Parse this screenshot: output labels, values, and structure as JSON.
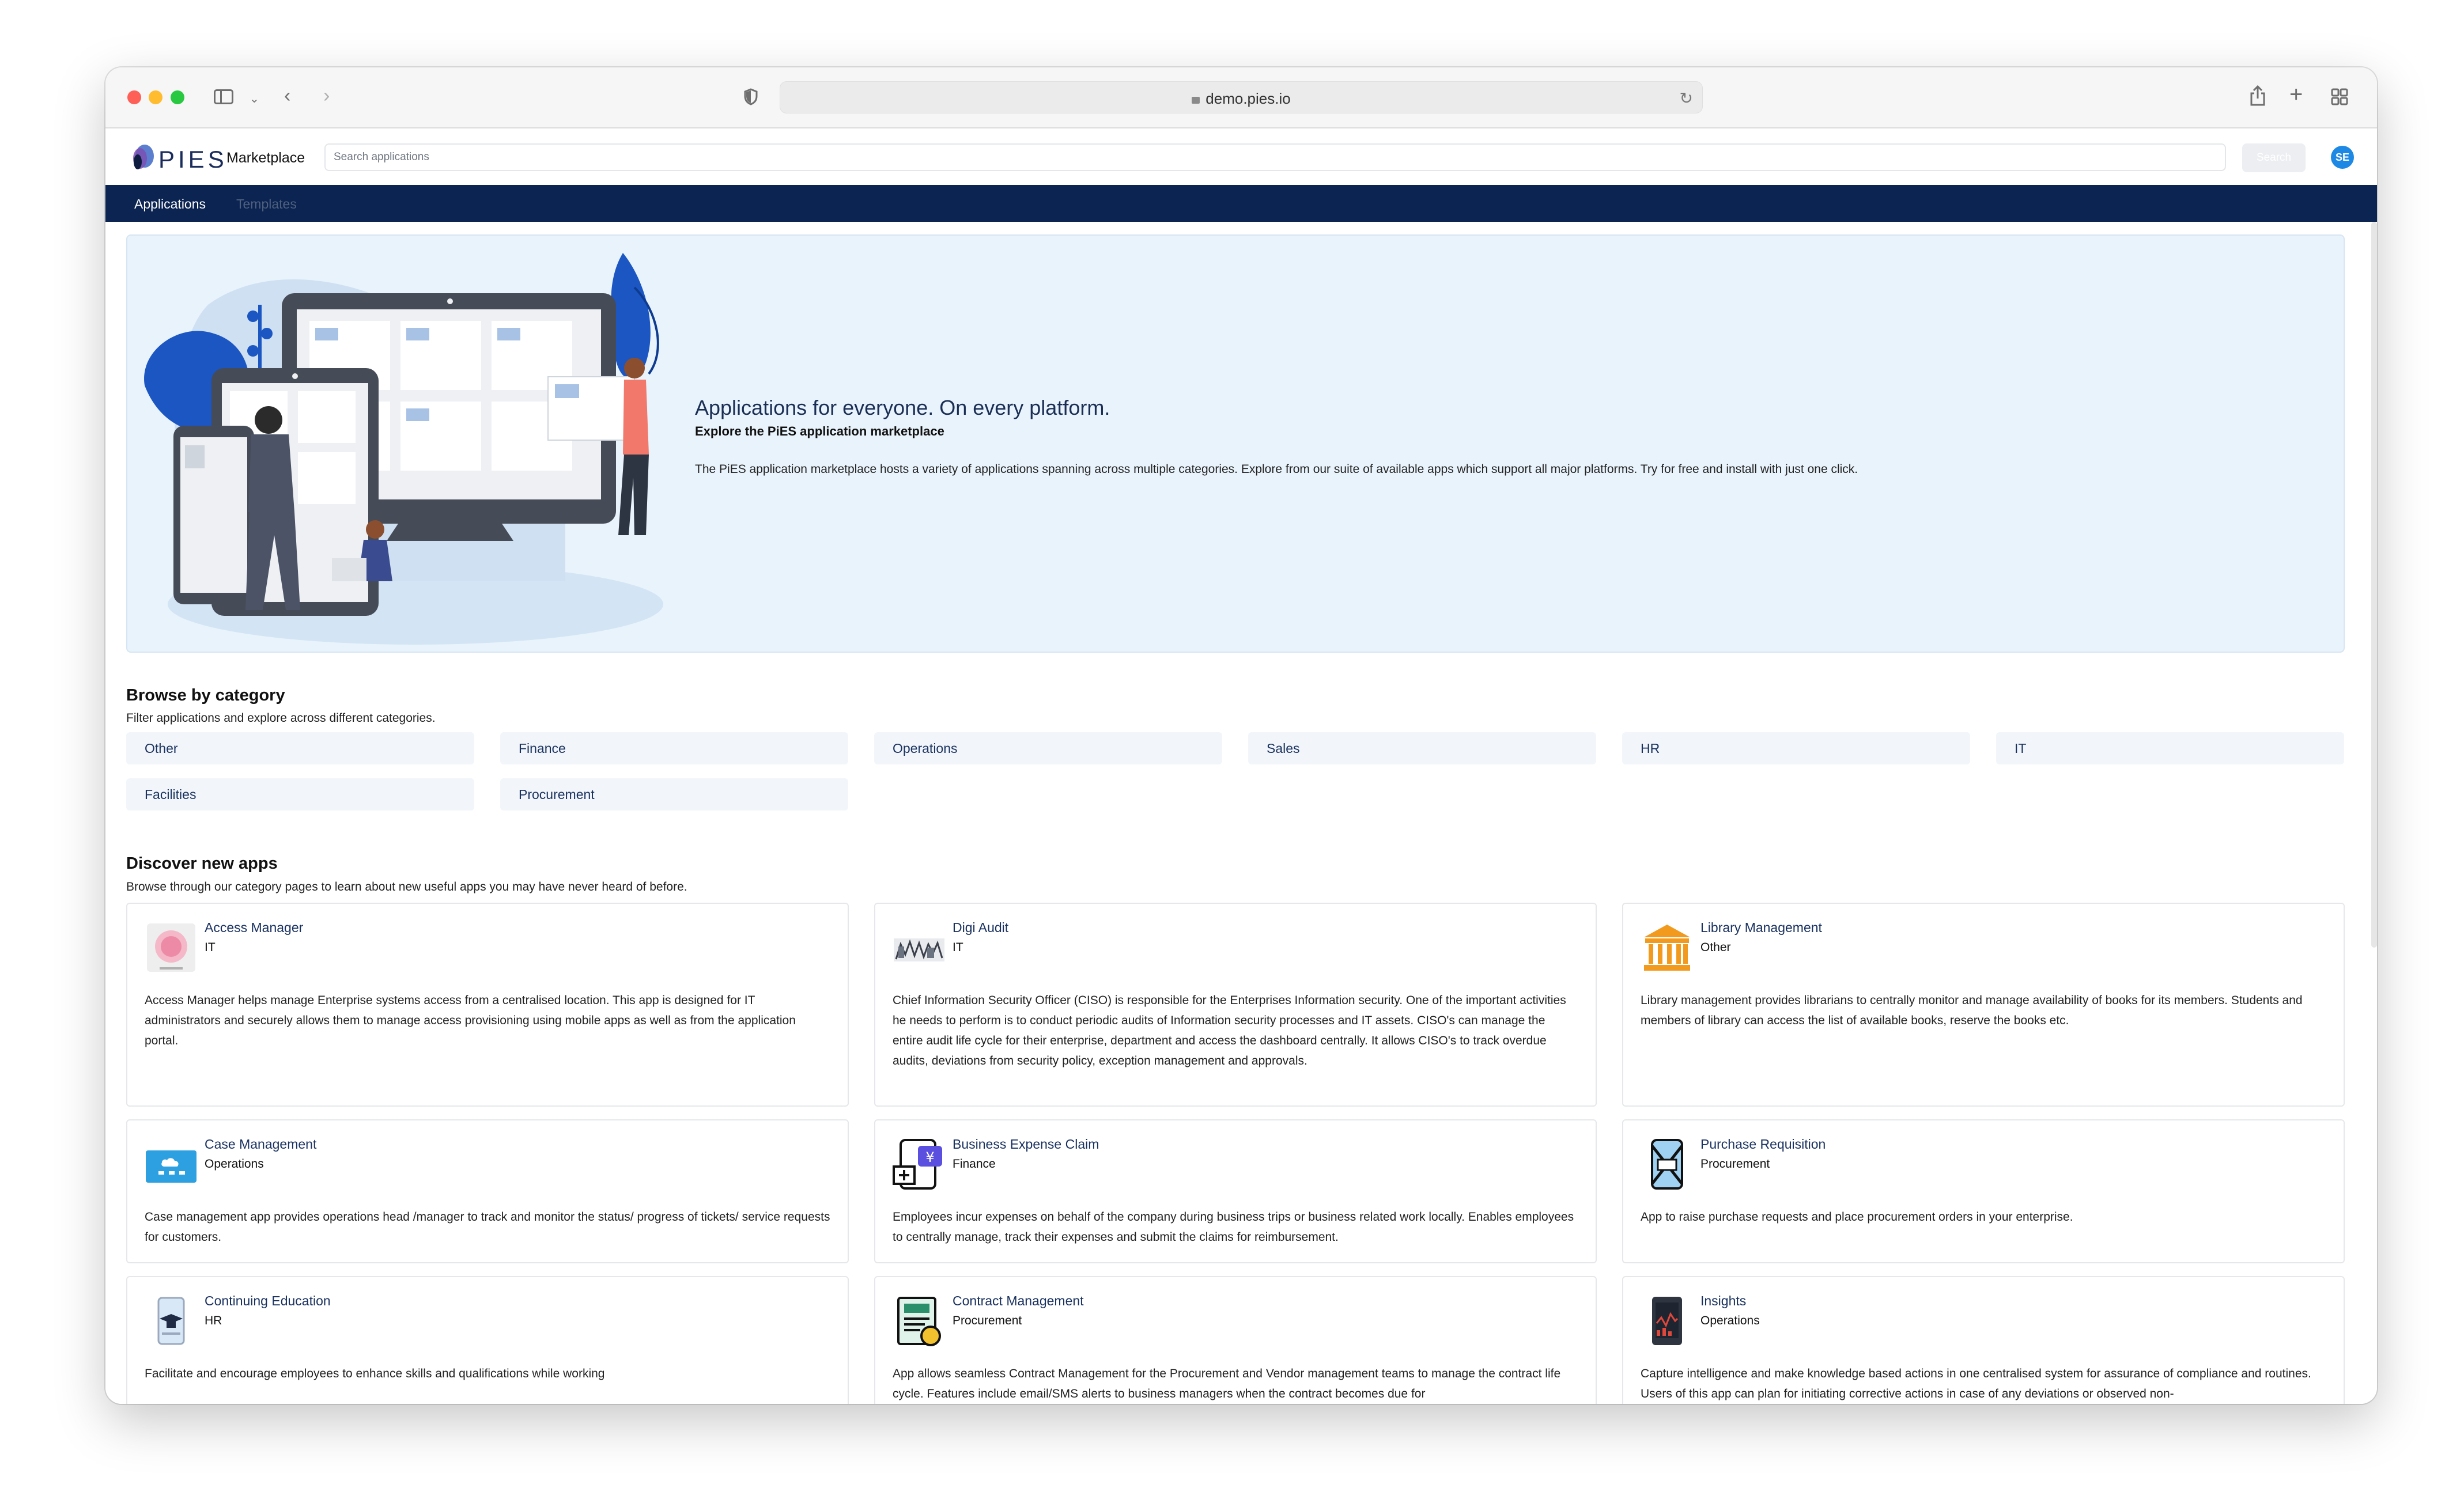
{
  "browser": {
    "url": "demo.pies.io"
  },
  "header": {
    "logo_text": "PIES",
    "marketplace": "Marketplace",
    "search_placeholder": "Search applications",
    "search_button": "Search",
    "avatar_initials": "SE"
  },
  "nav": {
    "tabs": [
      {
        "label": "Applications",
        "active": true
      },
      {
        "label": "Templates",
        "active": false
      }
    ]
  },
  "hero": {
    "title": "Applications for everyone. On every platform.",
    "subtitle": "Explore the PiES application marketplace",
    "body": "The PiES application marketplace hosts a variety of applications spanning across multiple categories. Explore from our suite of available apps which support all major platforms. Try for free and install with just one click."
  },
  "categories": {
    "title": "Browse by category",
    "description": "Filter applications and explore across different categories.",
    "items": [
      "Other",
      "Finance",
      "Operations",
      "Sales",
      "HR",
      "IT",
      "Facilities",
      "Procurement"
    ]
  },
  "discover": {
    "title": "Discover new apps",
    "description": "Browse through our category pages to learn about new useful apps you may have never heard of before.",
    "apps": [
      {
        "name": "Access Manager",
        "category": "IT",
        "icon": "access-manager-icon",
        "description": "Access Manager helps manage Enterprise systems access from a centralised location. This app is designed for IT administrators and securely allows them to manage access provisioning using mobile apps as well as from the application portal."
      },
      {
        "name": "Digi Audit",
        "category": "IT",
        "icon": "digi-audit-icon",
        "description": "Chief Information Security Officer (CISO) is responsible for the Enterprises Information security. One of the important activities he needs to perform is to conduct periodic audits of Information security processes and IT assets. CISO's can manage the entire audit life cycle for their enterprise, department and access the dashboard centrally. It allows CISO's to track overdue audits, deviations from security policy, exception management and approvals."
      },
      {
        "name": "Library Management",
        "category": "Other",
        "icon": "library-icon",
        "description": "Library management provides librarians to centrally monitor and manage availability of books for its members. Students and members of library can access the list of available books, reserve the books etc."
      },
      {
        "name": "Case Management",
        "category": "Operations",
        "icon": "case-management-icon",
        "description": "Case management app provides operations head /manager to track and monitor the status/ progress of tickets/ service requests for customers."
      },
      {
        "name": "Business Expense Claim",
        "category": "Finance",
        "icon": "expense-claim-icon",
        "description": "Employees incur expenses on behalf of the company during business trips or business related work locally. Enables employees to centrally manage, track their expenses and submit the claims for reimbursement."
      },
      {
        "name": "Purchase Requisition",
        "category": "Procurement",
        "icon": "purchase-requisition-icon",
        "description": "App to raise purchase requests and place procurement orders in your enterprise."
      },
      {
        "name": "Continuing Education",
        "category": "HR",
        "icon": "education-icon",
        "description": "Facilitate and encourage employees to enhance skills and qualifications while working"
      },
      {
        "name": "Contract Management",
        "category": "Procurement",
        "icon": "contract-icon",
        "description": "App allows seamless Contract Management for the Procurement and Vendor management teams to manage the contract life cycle. Features include email/SMS alerts to business managers when the contract becomes due for"
      },
      {
        "name": "Insights",
        "category": "Operations",
        "icon": "insights-icon",
        "description": "Capture intelligence and make knowledge based actions in one centralised system for assurance of compliance and routines. Users of this app can plan for initiating corrective actions in case of any deviations or observed non-"
      }
    ]
  }
}
